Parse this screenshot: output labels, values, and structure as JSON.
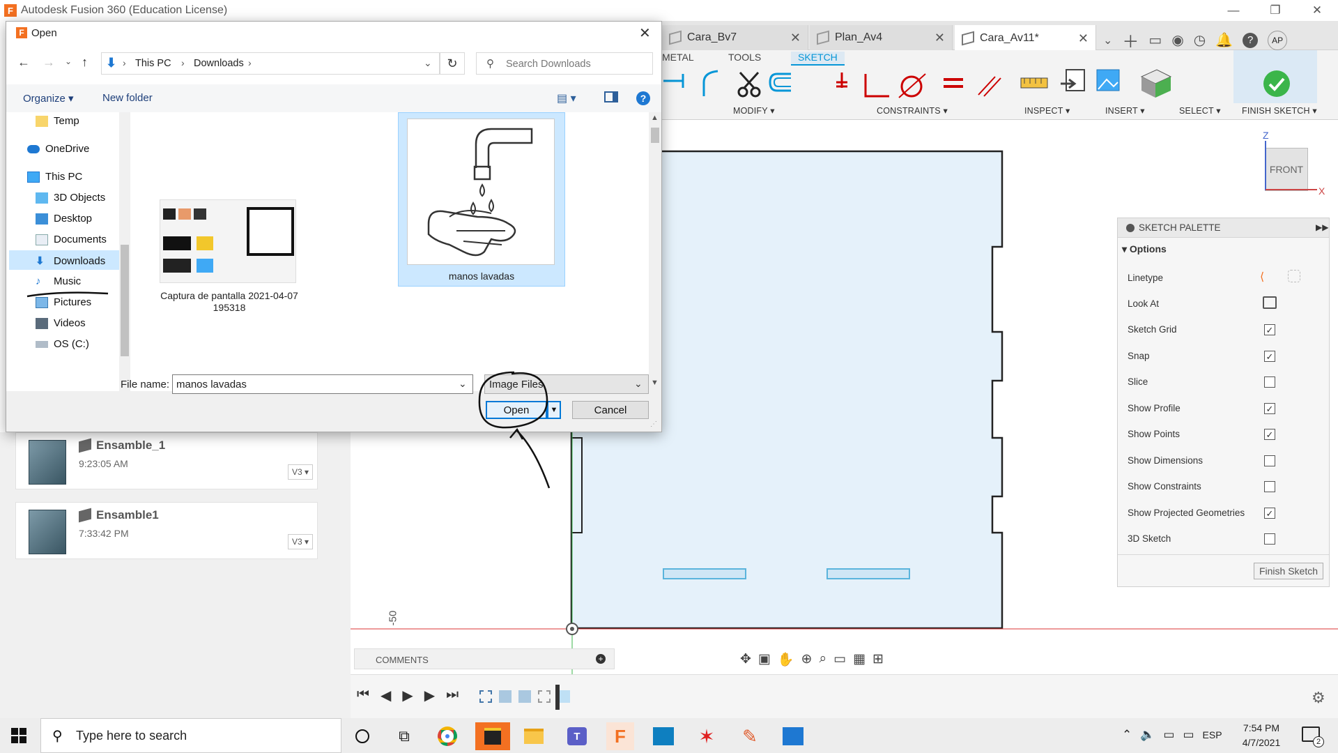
{
  "app": {
    "title": "Autodesk Fusion 360 (Education License)"
  },
  "doc_tabs": [
    {
      "label": "Cara_Bv7"
    },
    {
      "label": "Plan_Av4"
    },
    {
      "label": "Cara_Av11*"
    }
  ],
  "ribbon": {
    "tabs": [
      "METAL",
      "TOOLS",
      "SKETCH"
    ],
    "groups": [
      "MODIFY ▾",
      "CONSTRAINTS ▾",
      "INSPECT ▾",
      "INSERT ▾",
      "SELECT ▾",
      "FINISH SKETCH ▾"
    ]
  },
  "user": {
    "initials": "AP"
  },
  "viewcube": {
    "face": "FRONT",
    "z": "Z",
    "x": "X"
  },
  "canvas": {
    "dim_label": "-50"
  },
  "palette": {
    "title": "SKETCH PALETTE",
    "section": "Options",
    "rows": [
      {
        "label": "Linetype",
        "type": "icon"
      },
      {
        "label": "Look At",
        "type": "icon"
      },
      {
        "label": "Sketch Grid",
        "checked": "✓"
      },
      {
        "label": "Snap",
        "checked": "✓"
      },
      {
        "label": "Slice",
        "checked": ""
      },
      {
        "label": "Show Profile",
        "checked": "✓"
      },
      {
        "label": "Show Points",
        "checked": "✓"
      },
      {
        "label": "Show Dimensions",
        "checked": ""
      },
      {
        "label": "Show Constraints",
        "checked": ""
      },
      {
        "label": "Show Projected Geometries",
        "checked": "✓"
      },
      {
        "label": "3D Sketch",
        "checked": ""
      }
    ],
    "finish_button": "Finish Sketch"
  },
  "browser": {
    "items": [
      {
        "name": "Ensamble_1",
        "time": "9:23:05 AM",
        "version": "V3 ▾"
      },
      {
        "name": "Ensamble1",
        "time": "7:33:42 PM",
        "version": "V3 ▾"
      }
    ]
  },
  "comments": {
    "label": "COMMENTS"
  },
  "dialog": {
    "title": "Open",
    "breadcrumb": [
      "This PC",
      "Downloads"
    ],
    "search_placeholder": "Search Downloads",
    "organize": "Organize ▾",
    "new_folder": "New folder",
    "nav": [
      "Temp",
      "OneDrive",
      "This PC",
      "3D Objects",
      "Desktop",
      "Documents",
      "Downloads",
      "Music",
      "Pictures",
      "Videos",
      "OS (C:)"
    ],
    "files": [
      {
        "name": "Captura de pantalla 2021-04-07 195318"
      },
      {
        "name": "manos lavadas"
      }
    ],
    "file_name_label": "File name:",
    "file_name_value": "manos lavadas",
    "file_type": "Image Files",
    "open_button": "Open",
    "cancel_button": "Cancel"
  },
  "taskbar": {
    "search_placeholder": "Type here to search",
    "language": "ESP",
    "time": "7:54 PM",
    "date": "4/7/2021",
    "notification_count": "2"
  }
}
